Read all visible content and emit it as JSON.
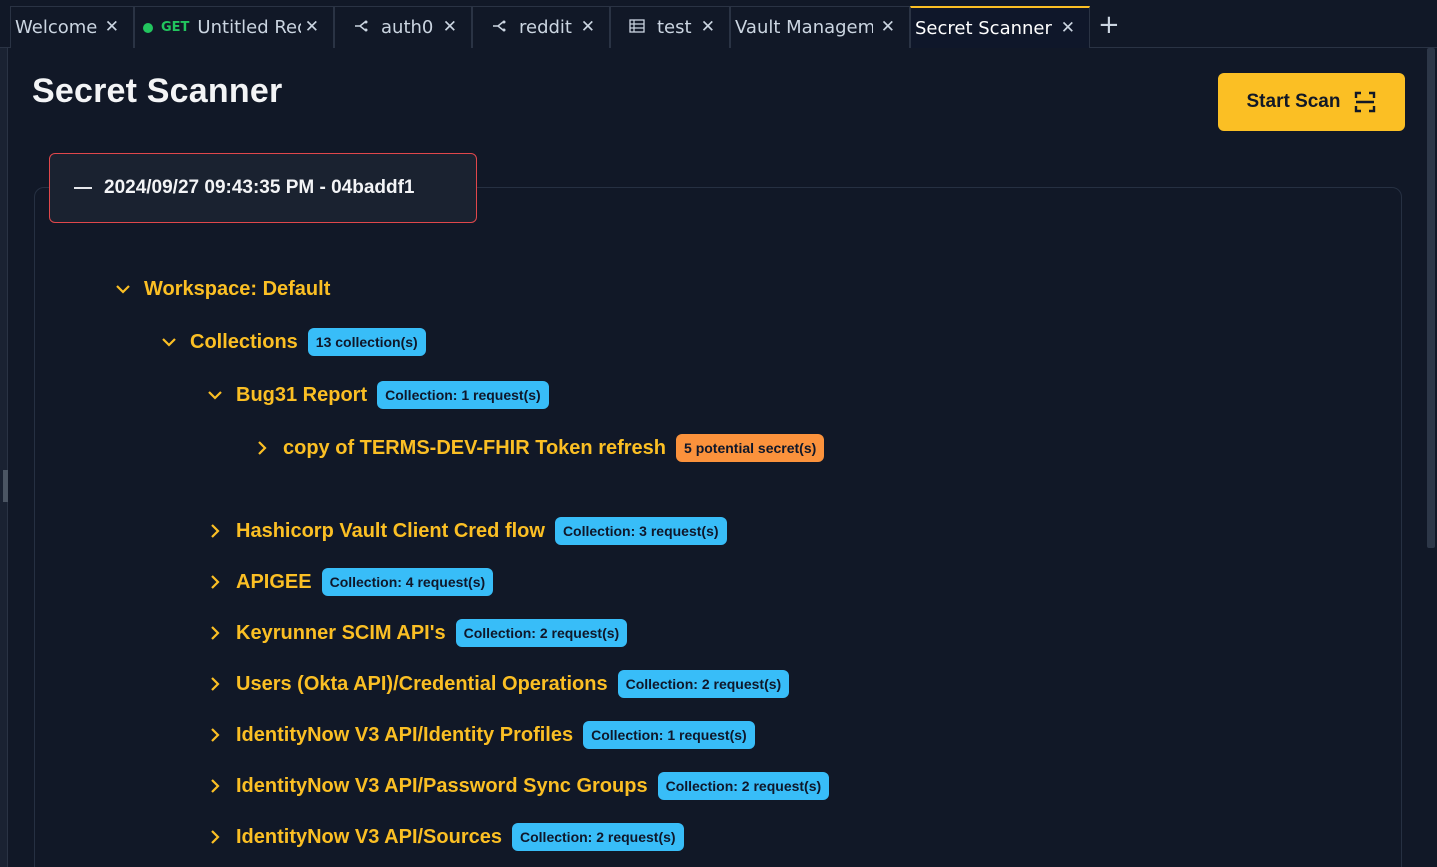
{
  "tabs": [
    {
      "label": "Welcome",
      "close": "✕"
    },
    {
      "method": "GET",
      "label": "Untitled Req",
      "close": "✕"
    },
    {
      "label": "auth0",
      "close": "✕"
    },
    {
      "label": "reddit",
      "close": "✕"
    },
    {
      "label": "test",
      "close": "✕"
    },
    {
      "label": "Vault Managem",
      "close": "✕"
    },
    {
      "label": "Secret Scanner",
      "close": "✕",
      "active": true
    }
  ],
  "add_tab": "+",
  "page": {
    "title": "Secret Scanner",
    "start_scan_label": "Start Scan"
  },
  "scan": {
    "header": "2024/09/27 09:43:35 PM - 04baddf1",
    "workspace": "Workspace: Default",
    "collections_label": "Collections",
    "collections_badge": "13 collection(s)",
    "expanded_collection": {
      "name": "Bug31 Report",
      "badge": "Collection: 1 request(s)",
      "request": {
        "name": "copy of TERMS-DEV-FHIR Token refresh",
        "badge": "5 potential secret(s)"
      }
    },
    "collections": [
      {
        "name": "Hashicorp Vault Client Cred flow",
        "badge": "Collection: 3 request(s)"
      },
      {
        "name": "APIGEE",
        "badge": "Collection: 4 request(s)"
      },
      {
        "name": "Keyrunner SCIM API's",
        "badge": "Collection: 2 request(s)"
      },
      {
        "name": "Users (Okta API)/Credential Operations",
        "badge": "Collection: 2 request(s)"
      },
      {
        "name": "IdentityNow V3 API/Identity Profiles",
        "badge": "Collection: 1 request(s)"
      },
      {
        "name": "IdentityNow V3 API/Password Sync Groups",
        "badge": "Collection: 2 request(s)"
      },
      {
        "name": "IdentityNow V3 API/Sources",
        "badge": "Collection: 2 request(s)"
      }
    ]
  },
  "colors": {
    "accent": "#fbbf24",
    "badge_info": "#38bdf8",
    "badge_warning": "#fb923c",
    "background": "#111827",
    "scan_header_border": "#e0474b"
  }
}
